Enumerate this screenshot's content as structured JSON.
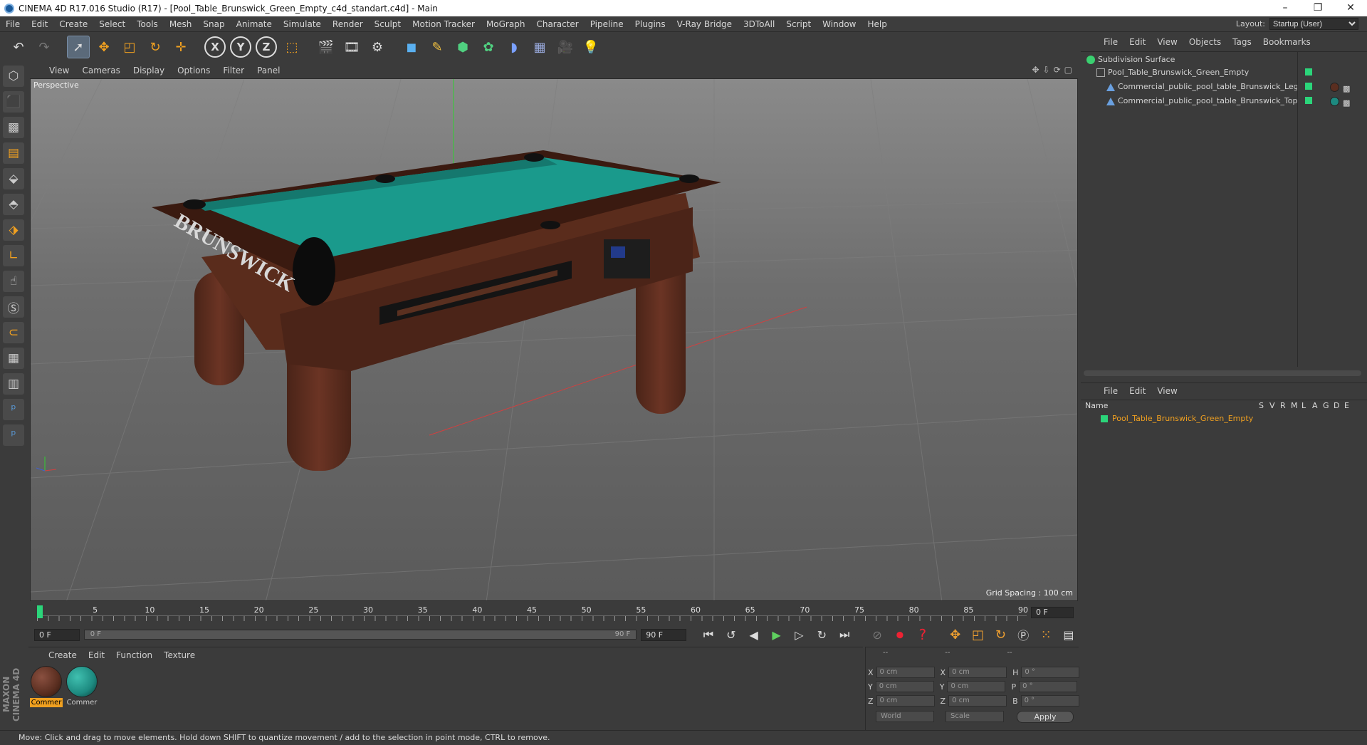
{
  "window": {
    "title": "CINEMA 4D R17.016 Studio (R17) - [Pool_Table_Brunswick_Green_Empty_c4d_standart.c4d] - Main",
    "controls": [
      "–",
      "❐",
      "✕"
    ]
  },
  "menubar": {
    "items": [
      "File",
      "Edit",
      "Create",
      "Select",
      "Tools",
      "Mesh",
      "Snap",
      "Animate",
      "Simulate",
      "Render",
      "Sculpt",
      "Motion Tracker",
      "MoGraph",
      "Character",
      "Pipeline",
      "Plugins",
      "V-Ray Bridge",
      "3DToAll",
      "Script",
      "Window",
      "Help"
    ],
    "layout_label": "Layout:",
    "layout_value": "Startup (User)"
  },
  "toolbar": {
    "axis_x": "X",
    "axis_y": "Y",
    "axis_z": "Z"
  },
  "viewport": {
    "menu": [
      "View",
      "Cameras",
      "Display",
      "Options",
      "Filter",
      "Panel"
    ],
    "label": "Perspective",
    "grid_spacing": "Grid Spacing : 100 cm",
    "brand_text": "BRUNSWICK",
    "colors": {
      "felt": "#1a9a8c",
      "wood": "#5a2c1c",
      "background": "#6d6d6d"
    }
  },
  "timeline": {
    "ticks": [
      "0",
      "5",
      "10",
      "15",
      "20",
      "25",
      "30",
      "35",
      "40",
      "45",
      "50",
      "55",
      "60",
      "65",
      "70",
      "75",
      "80",
      "85",
      "90"
    ],
    "current_frame": "0 F"
  },
  "playback": {
    "start_field": "0 F",
    "range_start": "0 F",
    "range_end": "90 F",
    "end_field": "90 F"
  },
  "materials": {
    "menu": [
      "Create",
      "Edit",
      "Function",
      "Texture"
    ],
    "items": [
      {
        "name": "Commer",
        "color": "#5a2e20",
        "selected": true
      },
      {
        "name": "Commer",
        "color": "#1d8a80",
        "selected": false
      }
    ]
  },
  "coordinates": {
    "header": [
      "--",
      "--",
      "--"
    ],
    "rows": [
      {
        "a": "X",
        "a_val": "0 cm",
        "b": "X",
        "b_val": "0 cm",
        "c": "H",
        "c_val": "0 °"
      },
      {
        "a": "Y",
        "a_val": "0 cm",
        "b": "Y",
        "b_val": "0 cm",
        "c": "P",
        "c_val": "0 °"
      },
      {
        "a": "Z",
        "a_val": "0 cm",
        "b": "Z",
        "b_val": "0 cm",
        "c": "B",
        "c_val": "0 °"
      }
    ],
    "mode": "World",
    "type": "Scale",
    "apply": "Apply"
  },
  "object_manager": {
    "menu": [
      "File",
      "Edit",
      "View",
      "Objects",
      "Tags",
      "Bookmarks"
    ],
    "objects": [
      {
        "name": "Subdivision Surface"
      },
      {
        "name": "Pool_Table_Brunswick_Green_Empty"
      },
      {
        "name": "Commercial_public_pool_table_Brunswick_Leg"
      },
      {
        "name": "Commercial_public_pool_table_Brunswick_Top"
      }
    ]
  },
  "layer_manager": {
    "menu": [
      "File",
      "Edit",
      "View"
    ],
    "columns": [
      "Name",
      "S",
      "V",
      "R",
      "M",
      "L",
      "A",
      "G",
      "D",
      "E"
    ],
    "rows": [
      {
        "name": "Pool_Table_Brunswick_Green_Empty"
      }
    ]
  },
  "status": {
    "text": "Move: Click and drag to move elements. Hold down SHIFT to quantize movement / add to the selection in point mode, CTRL to remove."
  }
}
